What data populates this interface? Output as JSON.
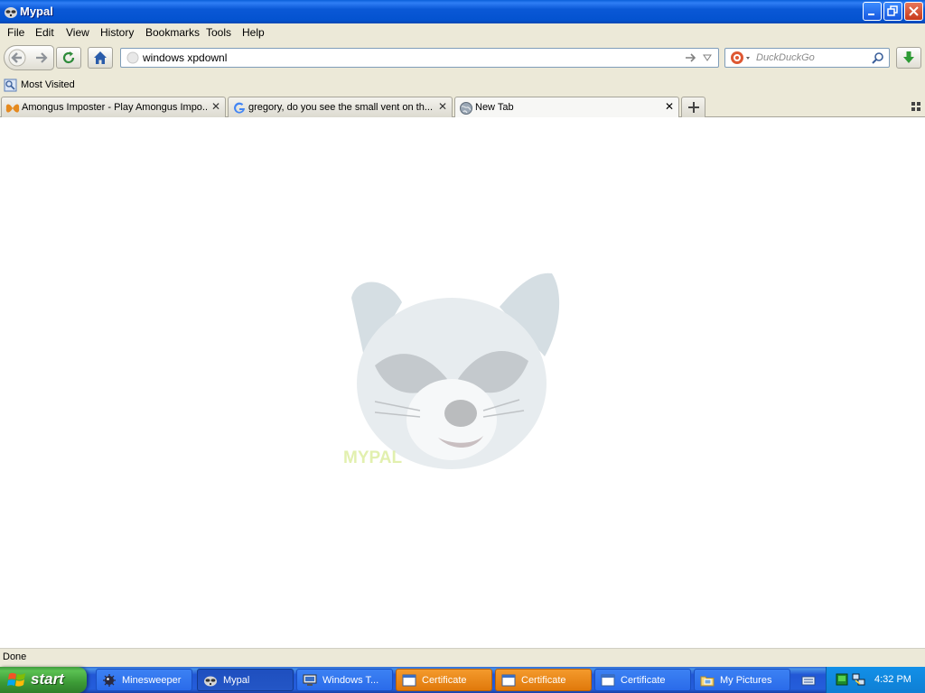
{
  "window": {
    "title": "Mypal"
  },
  "menu": [
    "File",
    "Edit",
    "View",
    "History",
    "Bookmarks",
    "Tools",
    "Help"
  ],
  "urlbar": {
    "value": "windows xpdownl"
  },
  "search": {
    "placeholder": "DuckDuckGo"
  },
  "bookmarks": {
    "most_visited": "Most Visited"
  },
  "tabs": [
    {
      "label": "Amongus Imposter - Play Amongus Impo..."
    },
    {
      "label": "gregory, do you see the small vent on th..."
    },
    {
      "label": "New Tab"
    }
  ],
  "content": {
    "watermark_text": "MYPAL"
  },
  "status": {
    "text": "Done"
  },
  "taskbar": {
    "start_label": "start",
    "items": [
      {
        "label": "Minesweeper"
      },
      {
        "label": "Mypal"
      },
      {
        "label": "Windows T..."
      },
      {
        "label": "Certificate"
      },
      {
        "label": "Certificate"
      },
      {
        "label": "Certificate"
      },
      {
        "label": "My Pictures"
      }
    ],
    "clock": "4:32 PM"
  },
  "colors": {
    "titlebar": "#0a58d6",
    "taskbar": "#245edb",
    "start_button": "#3c9b36",
    "tray": "#0f7fd4",
    "orange_task": "#e0790b"
  }
}
